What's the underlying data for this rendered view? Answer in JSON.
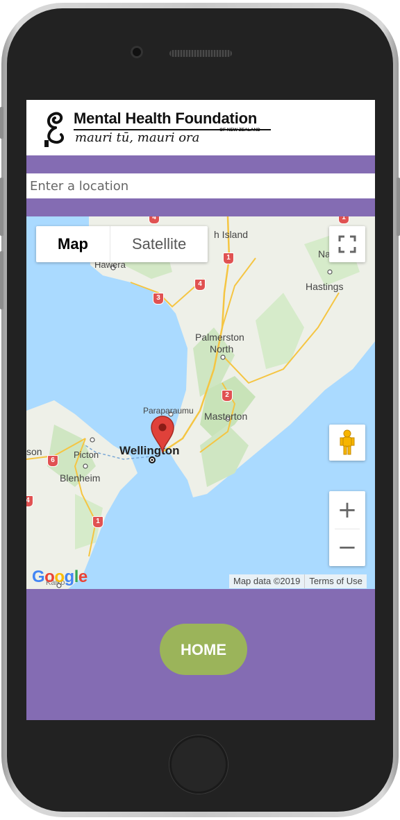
{
  "header": {
    "logo_title": "Mental Health Foundation",
    "logo_subtitle": "mauri tū, mauri ora",
    "logo_country": "OF NEW ZEALAND"
  },
  "search": {
    "placeholder": "Enter a location"
  },
  "map": {
    "type_tabs": [
      {
        "label": "Map",
        "selected": true
      },
      {
        "label": "Satellite",
        "selected": false
      }
    ],
    "labels": {
      "north_island": "h Island",
      "hawera": "Hawera",
      "napier": "Na",
      "hastings": "Hastings",
      "palmerston_1": "Palmerston",
      "palmerston_2": "North",
      "paraparaumu": "Paraparaumu",
      "masterton": "Masterton",
      "wellington": "Wellington",
      "picton": "Picton",
      "nelson": "son",
      "blenheim": "Blenheim",
      "kaikoura": "Kaiko"
    },
    "route_shields": [
      "1",
      "4",
      "3",
      "4",
      "1",
      "2",
      "6",
      "1",
      "4"
    ],
    "google_logo": "Google",
    "attribution": "Map data ©2019",
    "terms": "Terms of Use",
    "zoom_in": "+",
    "zoom_out": "−",
    "marker_location": "Wellington"
  },
  "footer": {
    "home_label": "HOME"
  },
  "colors": {
    "brand_purple": "#846cb3",
    "home_green": "#9bb45a",
    "marker_red": "#e0413a",
    "water": "#aadaff"
  },
  "icons": [
    "logo-mark-icon",
    "fullscreen-icon",
    "pegman-icon",
    "map-marker-icon"
  ]
}
